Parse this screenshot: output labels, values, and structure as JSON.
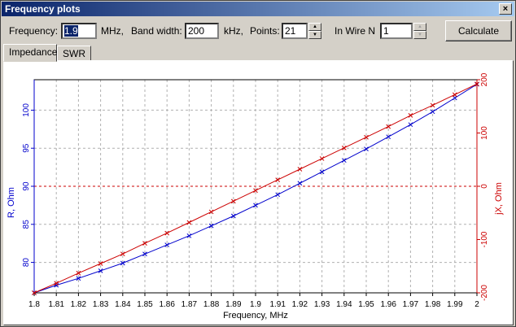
{
  "window": {
    "title": "Frequency plots",
    "close_glyph": "×"
  },
  "controls": {
    "frequency_label": "Frequency:",
    "frequency_value": "1.9",
    "frequency_unit": "MHz,",
    "bandwidth_label": "Band width:",
    "bandwidth_value": "200",
    "bandwidth_unit": "kHz,",
    "points_label": "Points:",
    "points_value": "21",
    "wire_label": "In Wire N",
    "wire_value": "1",
    "calculate_label": "Calculate"
  },
  "tabs": [
    {
      "label": "Impedance",
      "active": true
    },
    {
      "label": "SWR",
      "active": false
    }
  ],
  "colors": {
    "r_series": "#0000cc",
    "x_series": "#cc0000",
    "grid": "#b0b0b0",
    "zero_line": "#cc0000"
  },
  "chart_data": {
    "type": "line",
    "xlabel": "Frequency, MHz",
    "ylabel_left": "R, Ohm",
    "ylabel_right": "jX, Ohm",
    "x": [
      1.8,
      1.81,
      1.82,
      1.83,
      1.84,
      1.85,
      1.86,
      1.87,
      1.88,
      1.89,
      1.9,
      1.91,
      1.92,
      1.93,
      1.94,
      1.95,
      1.96,
      1.97,
      1.98,
      1.99,
      2.0
    ],
    "xlim": [
      1.8,
      2.0
    ],
    "x_ticks": [
      "1.8",
      "1.81",
      "1.82",
      "1.83",
      "1.84",
      "1.85",
      "1.86",
      "1.87",
      "1.88",
      "1.89",
      "1.9",
      "1.91",
      "1.92",
      "1.93",
      "1.94",
      "1.95",
      "1.96",
      "1.97",
      "1.98",
      "1.99",
      "2"
    ],
    "ylim_left": [
      76,
      104
    ],
    "y_ticks_left": [
      "80",
      "85",
      "90",
      "95",
      "100"
    ],
    "ylim_right": [
      -200,
      200
    ],
    "y_ticks_right": [
      "-200",
      "-100",
      "0",
      "100",
      "200"
    ],
    "grid": true,
    "zero_reference": 0,
    "series": [
      {
        "name": "R, Ohm",
        "axis": "left",
        "marker": "x",
        "values": [
          76.0,
          77.0,
          77.9,
          78.9,
          79.9,
          81.1,
          82.3,
          83.5,
          84.8,
          86.1,
          87.5,
          88.9,
          90.4,
          91.9,
          93.4,
          94.9,
          96.5,
          98.1,
          99.8,
          101.6,
          103.4
        ]
      },
      {
        "name": "jX, Ohm",
        "axis": "right",
        "marker": "x",
        "values": [
          -200,
          -182,
          -163,
          -145,
          -127,
          -107,
          -88,
          -68,
          -48,
          -28,
          -8,
          12,
          32,
          52,
          72,
          92,
          112,
          133,
          152,
          172,
          192
        ]
      }
    ]
  }
}
